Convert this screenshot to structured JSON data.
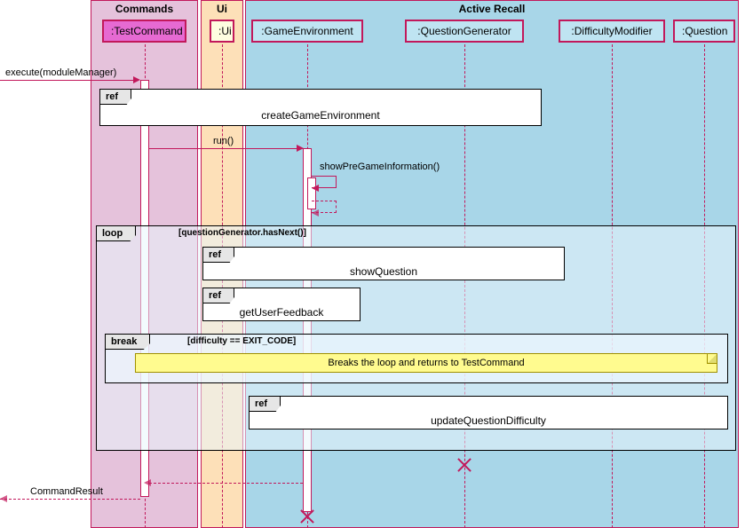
{
  "lanes": {
    "commands": {
      "title": "Commands"
    },
    "ui": {
      "title": "Ui"
    },
    "active_recall": {
      "title": "Active Recall"
    }
  },
  "lifelines": {
    "test_command": ":TestCommand",
    "ui": ":Ui",
    "game_environment": ":GameEnvironment",
    "question_generator": ":QuestionGenerator",
    "difficulty_modifier": ":DifficultyModifier",
    "question": ":Question"
  },
  "messages": {
    "execute": "execute(moduleManager)",
    "run": "run()",
    "show_pre_game": "showPreGameInformation()",
    "command_result": "CommandResult"
  },
  "refs": {
    "create_env": {
      "tag": "ref",
      "title": "createGameEnvironment"
    },
    "show_question": {
      "tag": "ref",
      "title": "showQuestion"
    },
    "get_feedback": {
      "tag": "ref",
      "title": "getUserFeedback"
    },
    "update_diff": {
      "tag": "ref",
      "title": "updateQuestionDifficulty"
    }
  },
  "frames": {
    "loop": {
      "tag": "loop",
      "guard": "[questionGenerator.hasNext()]"
    },
    "break": {
      "tag": "break",
      "guard": "[difficulty == EXIT_CODE]"
    }
  },
  "note": {
    "break_note": "Breaks the loop and returns to TestCommand"
  }
}
